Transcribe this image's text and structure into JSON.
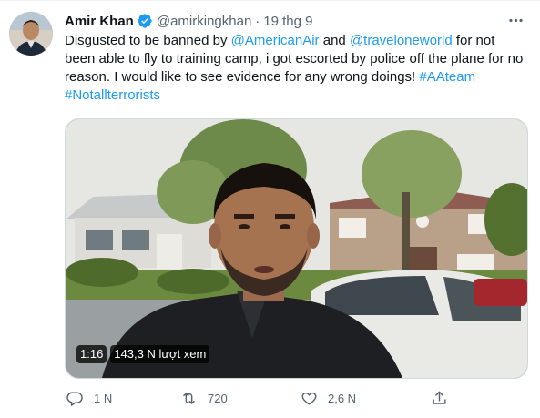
{
  "tweet": {
    "author_name": "Amir Khan",
    "handle": "@amirkingkhan",
    "separator": "·",
    "date": "19 thg 9",
    "text": {
      "part1": "Disgusted to be banned by ",
      "mention1": "@AmericanAir",
      "part2": " and ",
      "mention2": "@traveloneworld",
      "part3": " for not been able to fly to training camp, i got escorted by police off the plane for no reason. I would like to see evidence for any wrong doings! ",
      "hashtag1": "#AAteam",
      "hashtag2": "#Notallterrorists"
    },
    "video": {
      "duration": "1:16",
      "views": "143,3 N lượt xem"
    },
    "actions": {
      "replies": "1 N",
      "retweets": "720",
      "likes": "2,6 N"
    },
    "icons": [
      "verified-badge-icon",
      "more-icon",
      "reply-icon",
      "retweet-icon",
      "like-icon",
      "share-icon"
    ],
    "colors": {
      "link": "#1d9bf0",
      "verified": "#1d9bf0",
      "secondary_text": "#536471",
      "primary_text": "#0f1419"
    }
  }
}
